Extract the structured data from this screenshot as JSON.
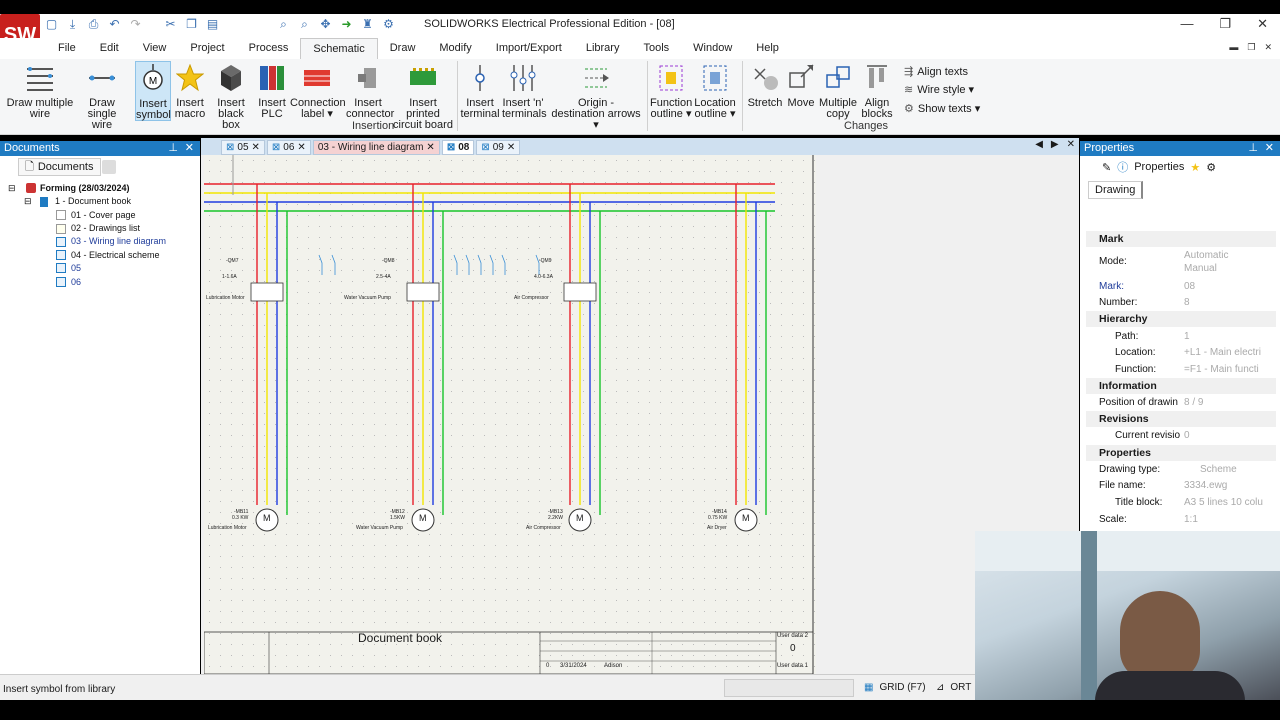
{
  "app": {
    "logo_text": "SW",
    "title": "SOLIDWORKS Electrical Professional Edition - [08]"
  },
  "menu": [
    "File",
    "Edit",
    "View",
    "Project",
    "Process",
    "Schematic",
    "Draw",
    "Modify",
    "Import/Export",
    "Library",
    "Tools",
    "Window",
    "Help"
  ],
  "ribbon": {
    "buttons": [
      {
        "line1": "Draw multiple",
        "line2": "wire"
      },
      {
        "line1": "Draw single",
        "line2": "wire"
      },
      {
        "line1": "Insert",
        "line2": "symbol"
      },
      {
        "line1": "Insert",
        "line2": "macro"
      },
      {
        "line1": "Insert",
        "line2": "black box"
      },
      {
        "line1": "Insert",
        "line2": "PLC"
      },
      {
        "line1": "Connection",
        "line2": "label ▾"
      },
      {
        "line1": "Insert",
        "line2": "connector"
      },
      {
        "line1": "Insert printed",
        "line2": "circuit board"
      },
      {
        "line1": "Insert",
        "line2": "terminal"
      },
      {
        "line1": "Insert 'n'",
        "line2": "terminals"
      },
      {
        "line1": "Origin -",
        "line2": "destination arrows ▾"
      },
      {
        "line1": "Function",
        "line2": "outline ▾"
      },
      {
        "line1": "Location",
        "line2": "outline ▾"
      },
      {
        "line1": "Stretch",
        "line2": ""
      },
      {
        "line1": "Move",
        "line2": ""
      },
      {
        "line1": "Multiple",
        "line2": "copy"
      },
      {
        "line1": "Align",
        "line2": "blocks"
      }
    ],
    "small": [
      "Align texts",
      "Wire style ▾",
      "Show texts ▾"
    ],
    "groups": {
      "insertion": "Insertion",
      "changes": "Changes"
    }
  },
  "documents": {
    "panel_title": "Documents",
    "tab_label": "Documents",
    "tree": [
      {
        "label": "Forming (28/03/2024)",
        "bold": true
      },
      {
        "label": "1 - Document book"
      },
      {
        "label": "01 - Cover page"
      },
      {
        "label": "02 - Drawings list"
      },
      {
        "label": "03 - Wiring line diagram"
      },
      {
        "label": "04 - Electrical scheme"
      },
      {
        "label": "05"
      },
      {
        "label": "06"
      }
    ]
  },
  "tabs": [
    {
      "label": "05",
      "state": ""
    },
    {
      "label": "06",
      "state": ""
    },
    {
      "label": "03 - Wiring line diagram",
      "state": "act"
    },
    {
      "label": "08",
      "state": "cur"
    },
    {
      "label": "09",
      "state": ""
    }
  ],
  "drawing": {
    "breakers": [
      {
        "tag": "-QM7",
        "rating": "1-1.6A",
        "label": "Lubrication Motor"
      },
      {
        "tag": "-QM8",
        "rating": "2.5-4A",
        "label": "Water Vacuum Pump"
      },
      {
        "tag": "-QM9",
        "rating": "4.0-6.3A",
        "label": "Air Compressor"
      }
    ],
    "motors": [
      {
        "tag": "-MB11",
        "power": "0.3 KW",
        "label": "Lubrication Motor",
        "symbol": "M"
      },
      {
        "tag": "-MB12",
        "power": "1.5KW",
        "label": "Water Vacuum Pump",
        "symbol": "M"
      },
      {
        "tag": "-MB13",
        "power": "2.2KW",
        "label": "Air Compressor",
        "symbol": "M"
      },
      {
        "tag": "-MB14",
        "power": "0.75 KW",
        "label": "Air Dryer",
        "symbol": "M"
      }
    ],
    "title_block": {
      "title": "Document book",
      "user_data_2": "User data 2",
      "user_data_1": "User data 1",
      "sheet_num": "0",
      "rev": "0",
      "date": "3/31/2024",
      "author": "Adison"
    }
  },
  "properties": {
    "panel_title": "Properties",
    "tab_label": "Properties",
    "drawing_tab": "Drawing",
    "sections": {
      "mark": "Mark",
      "hierarchy": "Hierarchy",
      "information": "Information",
      "revisions": "Revisions",
      "properties": "Properties"
    },
    "rows": {
      "mode_label": "Mode:",
      "mode_auto": "Automatic",
      "mode_manual": "Manual",
      "mark_label": "Mark:",
      "mark_val": "08",
      "number_label": "Number:",
      "number_val": "8",
      "path_label": "Path:",
      "path_val": "1",
      "location_label": "Location:",
      "location_val": "+L1 - Main electri",
      "function_label": "Function:",
      "function_val": "=F1 - Main functi",
      "position_label": "Position of drawin",
      "position_val": "8 / 9",
      "revision_label": "Current revisio",
      "revision_val": "0",
      "dtype_label": "Drawing type:",
      "dtype_val": "Scheme",
      "file_label": "File name:",
      "file_val": "3334.ewg",
      "tblock_label": "Title block:",
      "tblock_val": "A3 5 lines 10 colu",
      "scale_label": "Scale:",
      "scale_val": "1:1"
    }
  },
  "status": {
    "hint": "Insert symbol from library",
    "grid": "GRID (F7)",
    "ortho": "ORT"
  },
  "colors": {
    "accent": "#1f7bc2",
    "wire_red": "#e8202a",
    "wire_yellow": "#f2e600",
    "wire_blue": "#1f3ce0",
    "wire_green": "#18c42a"
  }
}
